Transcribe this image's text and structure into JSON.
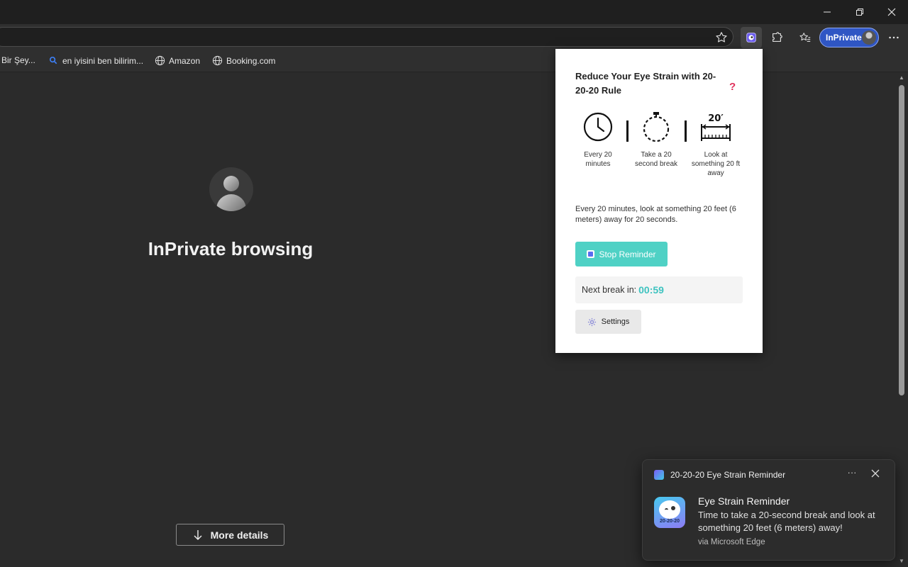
{
  "window": {
    "minimize_icon": "minimize-icon",
    "restore_icon": "restore-icon",
    "close_icon": "close-icon"
  },
  "toolbar": {
    "profile_label": "InPrivate",
    "icons": [
      "favorite-star-icon",
      "eye-strain-extension-icon",
      "extensions-icon",
      "favorites-icon",
      "more-menu-icon"
    ]
  },
  "favorites": [
    {
      "label": "Bir Şey...",
      "icon": "none"
    },
    {
      "label": "en iyisini ben bilirim...",
      "icon": "search-icon"
    },
    {
      "label": "Amazon",
      "icon": "globe-icon"
    },
    {
      "label": "Booking.com",
      "icon": "globe-icon"
    }
  ],
  "page": {
    "title": "InPrivate browsing",
    "more_details": "More details"
  },
  "popup": {
    "title": "Reduce Your Eye Strain with 20-20-20 Rule",
    "help": "?",
    "rules": [
      {
        "label": "Every 20 minutes",
        "icon": "clock-icon"
      },
      {
        "label": "Take a 20 second break",
        "icon": "stopwatch-icon"
      },
      {
        "label": "Look at something 20 ft away",
        "icon": "distance-ruler-icon"
      }
    ],
    "ruler_text": "20′",
    "description": "Every 20 minutes, look at something 20 feet (6 meters) away for 20 seconds.",
    "stop_button": "Stop Reminder",
    "next_break_label": "Next break in:",
    "next_break_time": "00:59",
    "settings_button": "Settings",
    "colors": {
      "accent": "#4fd1c5",
      "timer": "#3fc3c0",
      "help": "#e0305a"
    }
  },
  "notification": {
    "app_name": "20-20-20 Eye Strain Reminder",
    "more": "···",
    "title": "Eye Strain Reminder",
    "body": "Time to take a 20-second break and look at something 20 feet (6 meters) away!",
    "via": "via Microsoft Edge",
    "logo_text": "20-20-20"
  }
}
